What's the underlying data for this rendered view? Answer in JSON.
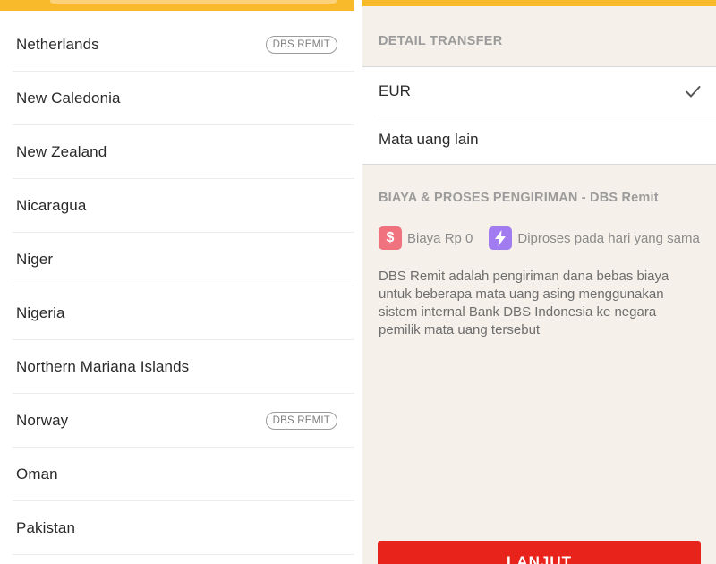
{
  "colors": {
    "accent_yellow": "#f8b92a",
    "button_red": "#e8231c",
    "fee_dollar_pink": "#f0727f",
    "fee_bolt_purple": "#a07cf0",
    "right_background": "#f5f0ea"
  },
  "country_list": [
    {
      "name": "Netherlands",
      "badge": "DBS REMIT"
    },
    {
      "name": "New Caledonia",
      "badge": null
    },
    {
      "name": "New Zealand",
      "badge": null
    },
    {
      "name": "Nicaragua",
      "badge": null
    },
    {
      "name": "Niger",
      "badge": null
    },
    {
      "name": "Nigeria",
      "badge": null
    },
    {
      "name": "Northern Mariana Islands",
      "badge": null
    },
    {
      "name": "Norway",
      "badge": "DBS REMIT"
    },
    {
      "name": "Oman",
      "badge": null
    },
    {
      "name": "Pakistan",
      "badge": null
    }
  ],
  "detail": {
    "section_title": "DETAIL TRANSFER",
    "currencies": [
      {
        "label": "EUR",
        "selected": true,
        "icon": "check-icon"
      },
      {
        "label": "Mata uang lain",
        "selected": false
      }
    ],
    "fee_title": "BIAYA & PROSES PENGIRIMAN - DBS Remit",
    "fees": [
      {
        "icon": "dollar-icon",
        "symbol": "$",
        "label": "Biaya Rp 0"
      },
      {
        "icon": "lightning-icon",
        "symbol": "⚡",
        "label": "Diproses pada hari yang sama"
      }
    ],
    "description": "DBS Remit adalah pengiriman dana bebas biaya untuk beberapa mata uang asing menggunakan sistem internal Bank DBS Indonesia ke negara pemilik mata uang tersebut",
    "button_label": "LANJUT"
  }
}
